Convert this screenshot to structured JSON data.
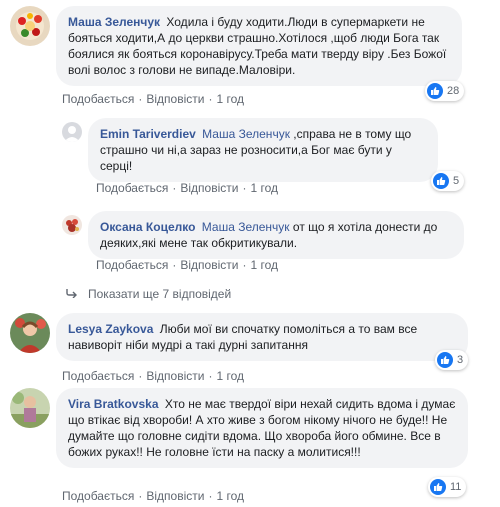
{
  "colors": {
    "link": "#385898",
    "bubble": "#f2f3f5",
    "meta": "#606770",
    "like": "#1877f2"
  },
  "actions": {
    "like": "Подобається",
    "reply": "Відповісти",
    "separator": "·"
  },
  "comments": [
    {
      "author": "Маша Зеленчук",
      "text": "Ходила і буду ходити.Люди в супермаркети не бояться ходити,А до церкви страшно.Хотілося ,щоб люди Бога так боялися як бояться коронавірусу.Треба мати тверду віру .Без Божої волі волос з голови не випаде.Маловіри.",
      "time": "1 год",
      "reactions": "28",
      "reaction_icon": "thumbs-up-icon"
    },
    {
      "author": "Emin Tariverdiev",
      "mention": "Маша Зеленчук",
      "text": ",справа не в тому що страшно чи ні,а зараз не розносити,а Бог має бути у серці!",
      "time": "1 год",
      "reactions": "5",
      "reaction_icon": "thumbs-up-icon"
    },
    {
      "author": "Оксана Коцелко",
      "mention": "Маша Зеленчук",
      "text": "от що я хотіла донести до деяких,які мене так обкритикували.",
      "time": "1 год"
    },
    {
      "author": "Lesya Zaykova",
      "text": "Люби мої ви спочатку помоліться а то вам все навиворіт ніби мудрі а такі дурні запитання",
      "time": "1 год",
      "reactions": "3",
      "reaction_icon": "thumbs-up-icon"
    },
    {
      "author": "Vira Bratkovska",
      "text": "Хто не має твердої віри нехай сидить вдома і думає що втікає від хвороби! А хто живе з богом нікому нічого не буде!! Не думайте що головне сидіти вдома. Що хвороба його обмине. Все в божих руках!! Не головне їсти на паску а молитися!!!",
      "time": "1 год",
      "reactions": "11",
      "reaction_icon": "thumbs-up-icon"
    }
  ],
  "more_replies": {
    "label": "Показати ще 7 відповідей",
    "icon": "reply-arrow-icon"
  }
}
